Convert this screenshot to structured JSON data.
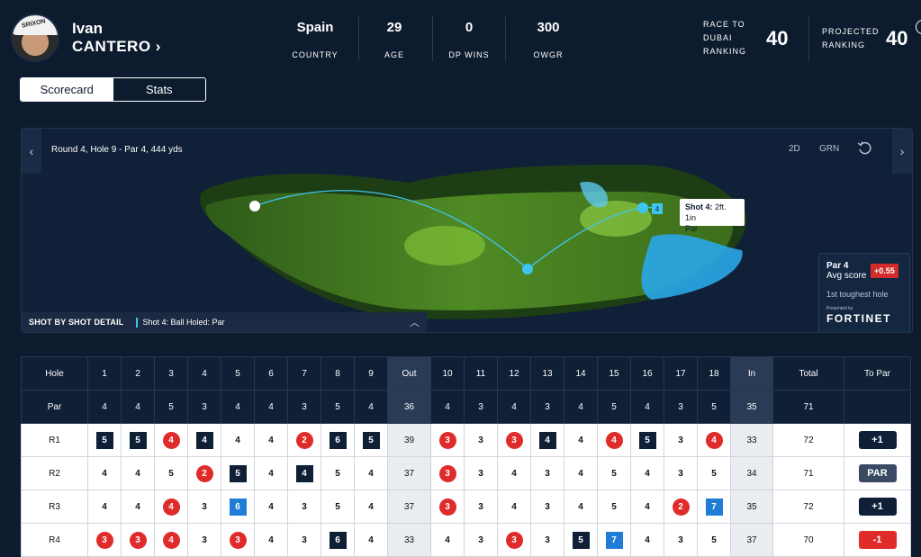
{
  "player": {
    "first_name": "Ivan",
    "last_name": "CANTERO",
    "chevron": "›",
    "avatar_text": "SRIXON"
  },
  "stats": [
    {
      "value": "Spain",
      "label": "COUNTRY"
    },
    {
      "value": "29",
      "label": "AGE"
    },
    {
      "value": "0",
      "label": "DP WINS"
    },
    {
      "value": "300",
      "label": "OWGR"
    }
  ],
  "race": {
    "label_lines": [
      "RACE TO",
      "DUBAI",
      "RANKING"
    ],
    "value": "40"
  },
  "projected": {
    "label_lines": [
      "PROJECTED",
      "RANKING"
    ],
    "value": "40"
  },
  "tabs": [
    {
      "label": "Scorecard",
      "active": true
    },
    {
      "label": "Stats",
      "active": false
    }
  ],
  "map": {
    "hole_info": "Round 4, Hole 9 - Par 4, 444 yds",
    "controls": [
      "2D",
      "GRN"
    ],
    "shot_detail_label": "SHOT BY SHOT DETAIL",
    "shot_detail_value": "Shot 4: Ball Holed: Par",
    "marker_number": "4",
    "tooltip": {
      "title": "Shot 4:",
      "distance": "2ft. 1in",
      "result": "Par"
    },
    "par_card": {
      "par": "Par 4",
      "avg_label": "Avg score",
      "avg_value": "+0.55",
      "toughness": "1st toughest hole",
      "presented_by": "Presented by",
      "sponsor": "FORTINET"
    }
  },
  "scorecard": {
    "headers": [
      "Hole",
      "1",
      "2",
      "3",
      "4",
      "5",
      "6",
      "7",
      "8",
      "9",
      "Out",
      "10",
      "11",
      "12",
      "13",
      "14",
      "15",
      "16",
      "17",
      "18",
      "In",
      "Total",
      "To Par"
    ],
    "par": [
      "Par",
      "4",
      "4",
      "5",
      "3",
      "4",
      "4",
      "3",
      "5",
      "4",
      "36",
      "4",
      "3",
      "4",
      "3",
      "4",
      "5",
      "4",
      "3",
      "5",
      "35",
      "71",
      ""
    ],
    "rounds": [
      {
        "label": "R1",
        "scores": [
          [
            "5",
            "bogey"
          ],
          [
            "5",
            "bogey"
          ],
          [
            "4",
            "birdie"
          ],
          [
            "4",
            "bogey"
          ],
          [
            "4",
            ""
          ],
          [
            "4",
            ""
          ],
          [
            "2",
            "birdie"
          ],
          [
            "6",
            "bogey"
          ],
          [
            "5",
            "bogey"
          ]
        ],
        "out": "39",
        "back": [
          [
            "3",
            "birdie"
          ],
          [
            "3",
            ""
          ],
          [
            "3",
            "birdie"
          ],
          [
            "4",
            "bogey"
          ],
          [
            "4",
            ""
          ],
          [
            "4",
            "birdie"
          ],
          [
            "5",
            "bogey"
          ],
          [
            "3",
            ""
          ],
          [
            "4",
            "birdie"
          ]
        ],
        "in": "33",
        "total": "72",
        "to_par": "+1",
        "tp_class": "under"
      },
      {
        "label": "R2",
        "scores": [
          [
            "4",
            ""
          ],
          [
            "4",
            ""
          ],
          [
            "5",
            ""
          ],
          [
            "2",
            "birdie"
          ],
          [
            "5",
            "bogey"
          ],
          [
            "4",
            ""
          ],
          [
            "4",
            "bogey"
          ],
          [
            "5",
            ""
          ],
          [
            "4",
            ""
          ]
        ],
        "out": "37",
        "back": [
          [
            "3",
            "birdie"
          ],
          [
            "3",
            ""
          ],
          [
            "4",
            ""
          ],
          [
            "3",
            ""
          ],
          [
            "4",
            ""
          ],
          [
            "5",
            ""
          ],
          [
            "4",
            ""
          ],
          [
            "3",
            ""
          ],
          [
            "5",
            ""
          ]
        ],
        "in": "34",
        "total": "71",
        "to_par": "PAR",
        "tp_class": "par"
      },
      {
        "label": "R3",
        "scores": [
          [
            "4",
            ""
          ],
          [
            "4",
            ""
          ],
          [
            "4",
            "birdie"
          ],
          [
            "3",
            ""
          ],
          [
            "6",
            "dbl"
          ],
          [
            "4",
            ""
          ],
          [
            "3",
            ""
          ],
          [
            "5",
            ""
          ],
          [
            "4",
            ""
          ]
        ],
        "out": "37",
        "back": [
          [
            "3",
            "birdie"
          ],
          [
            "3",
            ""
          ],
          [
            "4",
            ""
          ],
          [
            "3",
            ""
          ],
          [
            "4",
            ""
          ],
          [
            "5",
            ""
          ],
          [
            "4",
            ""
          ],
          [
            "2",
            "birdie"
          ],
          [
            "7",
            "dbl"
          ]
        ],
        "in": "35",
        "total": "72",
        "to_par": "+1",
        "tp_class": "under"
      },
      {
        "label": "R4",
        "scores": [
          [
            "3",
            "birdie"
          ],
          [
            "3",
            "birdie"
          ],
          [
            "4",
            "birdie"
          ],
          [
            "3",
            ""
          ],
          [
            "3",
            "birdie"
          ],
          [
            "4",
            ""
          ],
          [
            "3",
            ""
          ],
          [
            "6",
            "bogey"
          ],
          [
            "4",
            ""
          ]
        ],
        "out": "33",
        "back": [
          [
            "4",
            ""
          ],
          [
            "3",
            ""
          ],
          [
            "3",
            "birdie"
          ],
          [
            "3",
            ""
          ],
          [
            "5",
            "bogey"
          ],
          [
            "7",
            "dbl"
          ],
          [
            "4",
            ""
          ],
          [
            "3",
            ""
          ],
          [
            "5",
            ""
          ]
        ],
        "in": "37",
        "total": "70",
        "to_par": "-1",
        "tp_class": "over"
      }
    ]
  },
  "colors": {
    "background": "#0d1b2e",
    "birdie": "#e02b2b",
    "bogey": "#0f1f36",
    "double_bogey": "#1f7dd6",
    "accent": "#3fc6f0"
  }
}
